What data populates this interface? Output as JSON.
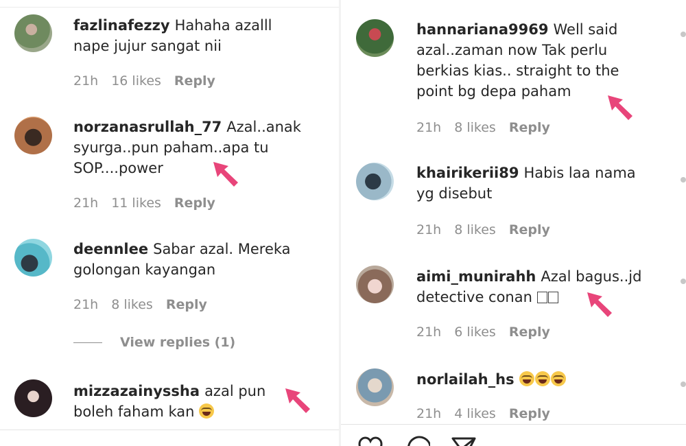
{
  "left": {
    "comments": [
      {
        "username": "fazlinafezzy",
        "text": "Hahaha azalll nape jujur sangat nii",
        "time": "21h",
        "likes": "16 likes",
        "reply": "Reply"
      },
      {
        "username": "norzanasrullah_77",
        "text": "Azal..anak syurga..pun paham..apa tu SOP....power",
        "time": "21h",
        "likes": "11 likes",
        "reply": "Reply"
      },
      {
        "username": "deennlee",
        "text": "Sabar azal. Mereka golongan kayangan",
        "time": "21h",
        "likes": "8 likes",
        "reply": "Reply",
        "view_replies": "View replies (1)"
      },
      {
        "username": "mizzazainyssha",
        "text": "azal pun boleh faham kan",
        "emoji": "face-with-tears-of-joy"
      }
    ]
  },
  "right": {
    "comments": [
      {
        "username": "hannariana9969",
        "text": "Well said azal..zaman now Tak perlu berkias kias.. straight to the point bg depa paham",
        "time": "21h",
        "likes": "8 likes",
        "reply": "Reply"
      },
      {
        "username": "khairikerii89",
        "text": "Habis laa nama yg disebut",
        "time": "21h",
        "likes": "8 likes",
        "reply": "Reply"
      },
      {
        "username": "aimi_munirahh",
        "text": "Azal bagus..jd detective conan",
        "time": "21h",
        "likes": "6 likes",
        "reply": "Reply"
      },
      {
        "username": "norlailah_hs",
        "text": "",
        "emoji": "face-with-tears-of-joy x3",
        "time": "21h",
        "likes": "4 likes",
        "reply": "Reply"
      }
    ],
    "action_icons": [
      "heart-icon",
      "comment-icon",
      "share-icon"
    ]
  },
  "colors": {
    "arrow": "#e8457a",
    "meta": "#8e8e8e",
    "text": "#262626"
  }
}
